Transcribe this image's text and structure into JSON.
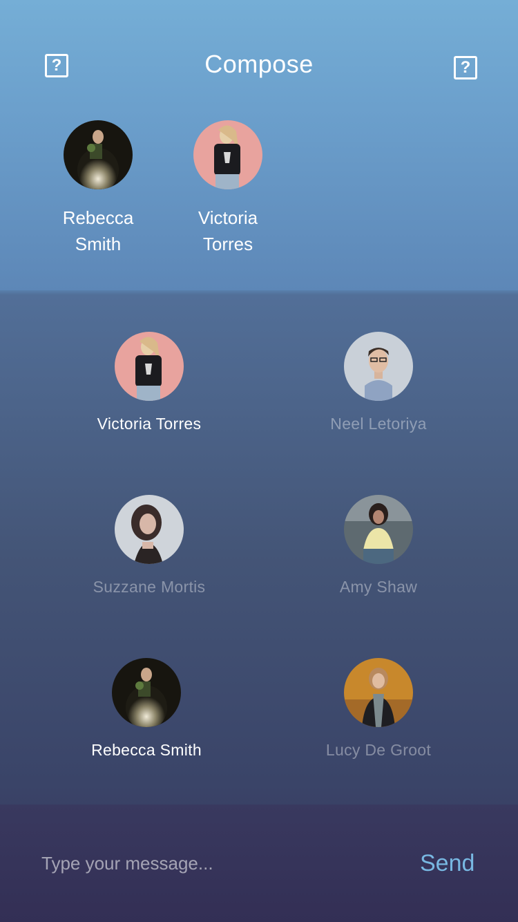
{
  "header": {
    "title": "Compose",
    "left_icon": "help-icon",
    "right_icon": "help-icon",
    "help_glyph": "?"
  },
  "selected": [
    {
      "first": "Rebecca",
      "last": "Smith",
      "photo": "woman-dark-dress"
    },
    {
      "first": "Victoria",
      "last": "Torres",
      "photo": "woman-pink-wall"
    }
  ],
  "contacts": [
    {
      "name": "Victoria Torres",
      "selected": true,
      "photo": "woman-pink-wall"
    },
    {
      "name": "Neel Letoriya",
      "selected": false,
      "photo": "man-glasses"
    },
    {
      "name": "Suzzane Mortis",
      "selected": false,
      "photo": "woman-curly-hair"
    },
    {
      "name": "Amy Shaw",
      "selected": false,
      "photo": "woman-yellow-shirt"
    },
    {
      "name": "Rebecca Smith",
      "selected": true,
      "photo": "woman-dark-dress"
    },
    {
      "name": "Lucy De Groot",
      "selected": false,
      "photo": "woman-scarf"
    }
  ],
  "composer": {
    "placeholder": "Type your message...",
    "send_label": "Send"
  },
  "colors": {
    "accent": "#78b8e2",
    "header_top": "#75aed6",
    "footer": "#332f55"
  }
}
